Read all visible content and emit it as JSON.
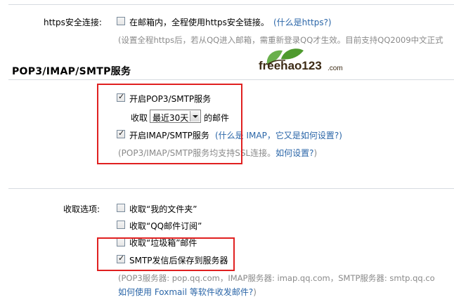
{
  "https": {
    "label": "https安全连接:",
    "option_text": "在邮箱内，全程使用https安全链接。",
    "help_link": "(什么是https?)",
    "note": "(设置全程https后，若从QQ进入邮箱，需重新登录QQ才生效。目前支持QQ2009中文正式",
    "checked": false
  },
  "section": {
    "title": "POP3/IMAP/SMTP服务"
  },
  "watermark": {
    "text": "freehao123",
    "suffix": ".com"
  },
  "pop3": {
    "enable_label": "开启POP3/SMTP服务",
    "enable_checked": true,
    "receive_prefix": "收取",
    "receive_select": "最近30天",
    "receive_suffix": "的邮件",
    "imap_label": "开启IMAP/SMTP服务",
    "imap_checked": true,
    "imap_help": "(什么是 IMAP，它又是如何设置?)",
    "ssl_note": "(POP3/IMAP/SMTP服务均支持SSL连接。",
    "ssl_link": "如何设置?",
    "ssl_note_end": ")"
  },
  "receive_options": {
    "label": "收取选项:",
    "items": [
      {
        "label": "收取“我的文件夹”",
        "checked": false
      },
      {
        "label": "收取“QQ邮件订阅”",
        "checked": false
      },
      {
        "label": "收取“垃圾箱”邮件",
        "checked": false
      },
      {
        "label": "SMTP发信后保存到服务器",
        "checked": true
      }
    ],
    "servers_note": "(POP3服务器: pop.qq.com，IMAP服务器: imap.qq.com，SMTP服务器: smtp.qq.co",
    "foxmail_link": "如何使用 Foxmail 等软件收发邮件?",
    "foxmail_end": ")"
  }
}
